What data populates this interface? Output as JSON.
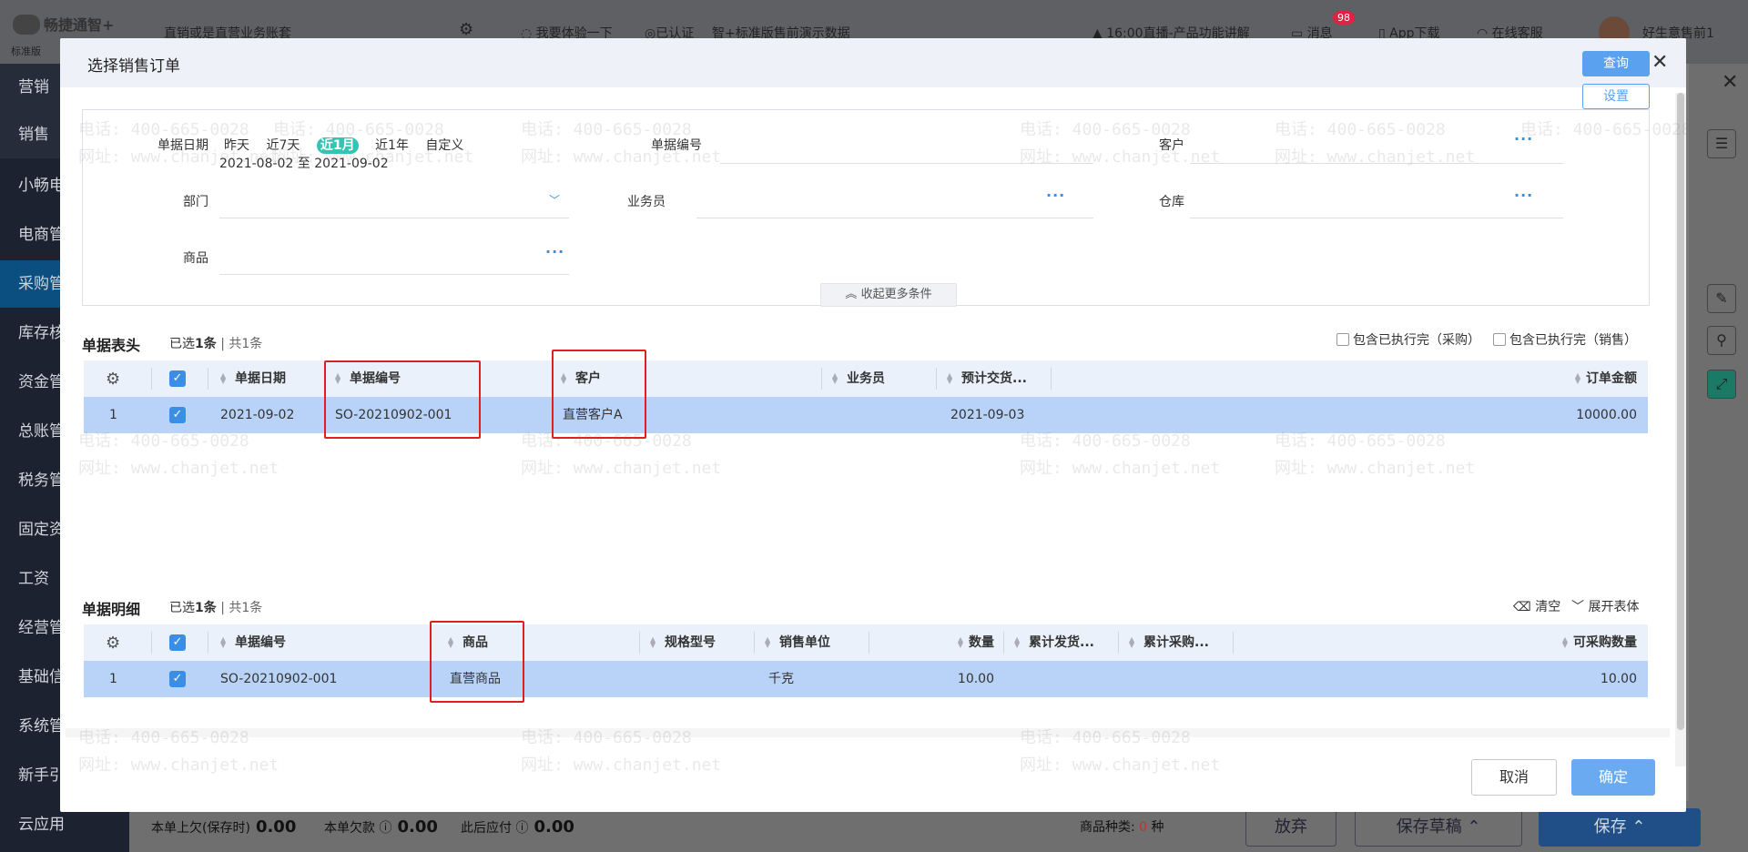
{
  "app": {
    "logo_name": "畅捷通智+",
    "logo_edition": "标准版",
    "account": "直销或是直营业务账套",
    "trial": "我要体验一下",
    "certified": "已认证",
    "demo_data": "智+标准版售前演示数据",
    "live": "16:00直播-产品功能讲解",
    "messages": "消息",
    "message_count": "98",
    "app_download": "App下载",
    "service": "在线客服",
    "user": "好生意售前1"
  },
  "sidebar": {
    "items": [
      "营销",
      "销售",
      "小畅电",
      "电商管",
      "采购管",
      "库存核",
      "资金管",
      "总账管",
      "税务管",
      "固定资",
      "工资",
      "经营管",
      "基础信",
      "系统管",
      "新手引",
      "云应用"
    ]
  },
  "bottombar": {
    "prev_owed_label": "本单上欠(保存时)",
    "prev_owed_value": "0.00",
    "owed_label": "本单欠款",
    "owed_value": "0.00",
    "after_payable_label": "此后应付",
    "after_payable_value": "0.00",
    "goods_kinds_label": "商品种类:",
    "goods_kinds_value": "0",
    "goods_kinds_unit": "种",
    "discard": "放弃",
    "save_draft": "保存草稿",
    "save": "保存"
  },
  "modal": {
    "title": "选择销售订单",
    "filter": {
      "date_label": "单据日期",
      "date_options": [
        "昨天",
        "近7天",
        "近1月",
        "近1年",
        "自定义"
      ],
      "date_selected": "近1月",
      "date_range": "2021-08-02 至 2021-09-02",
      "doc_no_label": "单据编号",
      "customer_label": "客户",
      "dept_label": "部门",
      "salesman_label": "业务员",
      "warehouse_label": "仓库",
      "goods_label": "商品",
      "query": "查询",
      "settings": "设置",
      "collapse": "收起更多条件"
    },
    "header_section": {
      "title": "单据表头",
      "selected_prefix": "已选",
      "selected_count": "1",
      "selected_unit": "条",
      "total": "| 共1条",
      "include_purchase": "包含已执行完（采购）",
      "include_sales": "包含已执行完（销售）",
      "columns": [
        "单据日期",
        "单据编号",
        "客户",
        "业务员",
        "预计交货...",
        "订单金额"
      ],
      "rows": [
        {
          "index": "1",
          "date": "2021-09-02",
          "doc_no": "SO-20210902-001",
          "customer": "直营客户A",
          "salesman": "",
          "delivery": "2021-09-03",
          "amount": "10000.00"
        }
      ]
    },
    "detail_section": {
      "title": "单据明细",
      "selected_prefix": "已选",
      "selected_count": "1",
      "selected_unit": "条",
      "total": "| 共1条",
      "clear": "清空",
      "expand": "展开表体",
      "columns": [
        "单据编号",
        "商品",
        "规格型号",
        "销售单位",
        "数量",
        "累计发货...",
        "累计采购...",
        "可采购数量"
      ],
      "rows": [
        {
          "index": "1",
          "doc_no": "SO-20210902-001",
          "goods": "直营商品",
          "spec": "",
          "unit": "千克",
          "qty": "10.00",
          "shipped": "",
          "purchased": "",
          "available": "10.00"
        }
      ]
    },
    "cancel": "取消",
    "confirm": "确定"
  },
  "watermark": {
    "phone": "电话: 400-665-0028",
    "site": "网址: www.chanjet.net"
  },
  "icons": {
    "close": "close-icon",
    "gear": "gear-icon",
    "more": "ellipsis-icon",
    "chevron": "chevron-down-icon"
  },
  "colors": {
    "primary": "#3a8ee6",
    "selected_row": "#b8d3f7",
    "highlight_box": "#e02020",
    "date_tag": "#35c4b3"
  }
}
